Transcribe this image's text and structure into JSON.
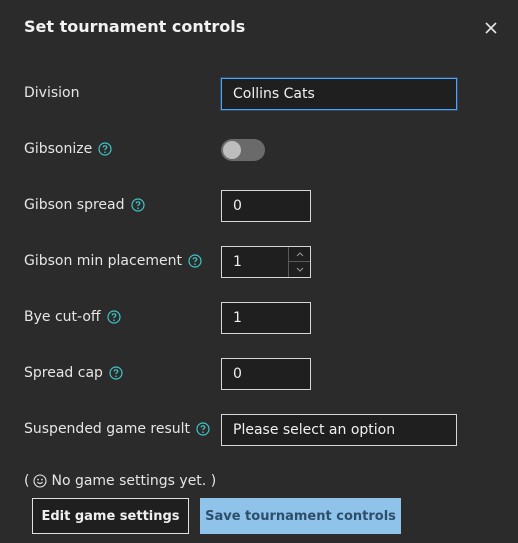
{
  "dialog": {
    "title": "Set tournament controls",
    "close_icon": "close-icon"
  },
  "fields": {
    "division": {
      "label": "Division",
      "value": "Collins Cats"
    },
    "gibsonize": {
      "label": "Gibsonize",
      "enabled": false
    },
    "gibson_spread": {
      "label": "Gibson spread",
      "value": "0"
    },
    "gibson_min_placement": {
      "label": "Gibson min placement",
      "value": "1"
    },
    "bye_cutoff": {
      "label": "Bye cut-off",
      "value": "1"
    },
    "spread_cap": {
      "label": "Spread cap",
      "value": "0"
    },
    "suspended_game_result": {
      "label": "Suspended game result",
      "placeholder": "Please select an option"
    }
  },
  "note": {
    "open_paren": "(",
    "text": "No game settings yet. )",
    "icon": "smile-icon"
  },
  "buttons": {
    "edit_game_settings": "Edit game settings",
    "save_tournament_controls": "Save tournament controls"
  },
  "colors": {
    "accent": "#4aa3ff",
    "help_icon": "#3fc6c6",
    "primary_button": "#8fc3ea"
  }
}
